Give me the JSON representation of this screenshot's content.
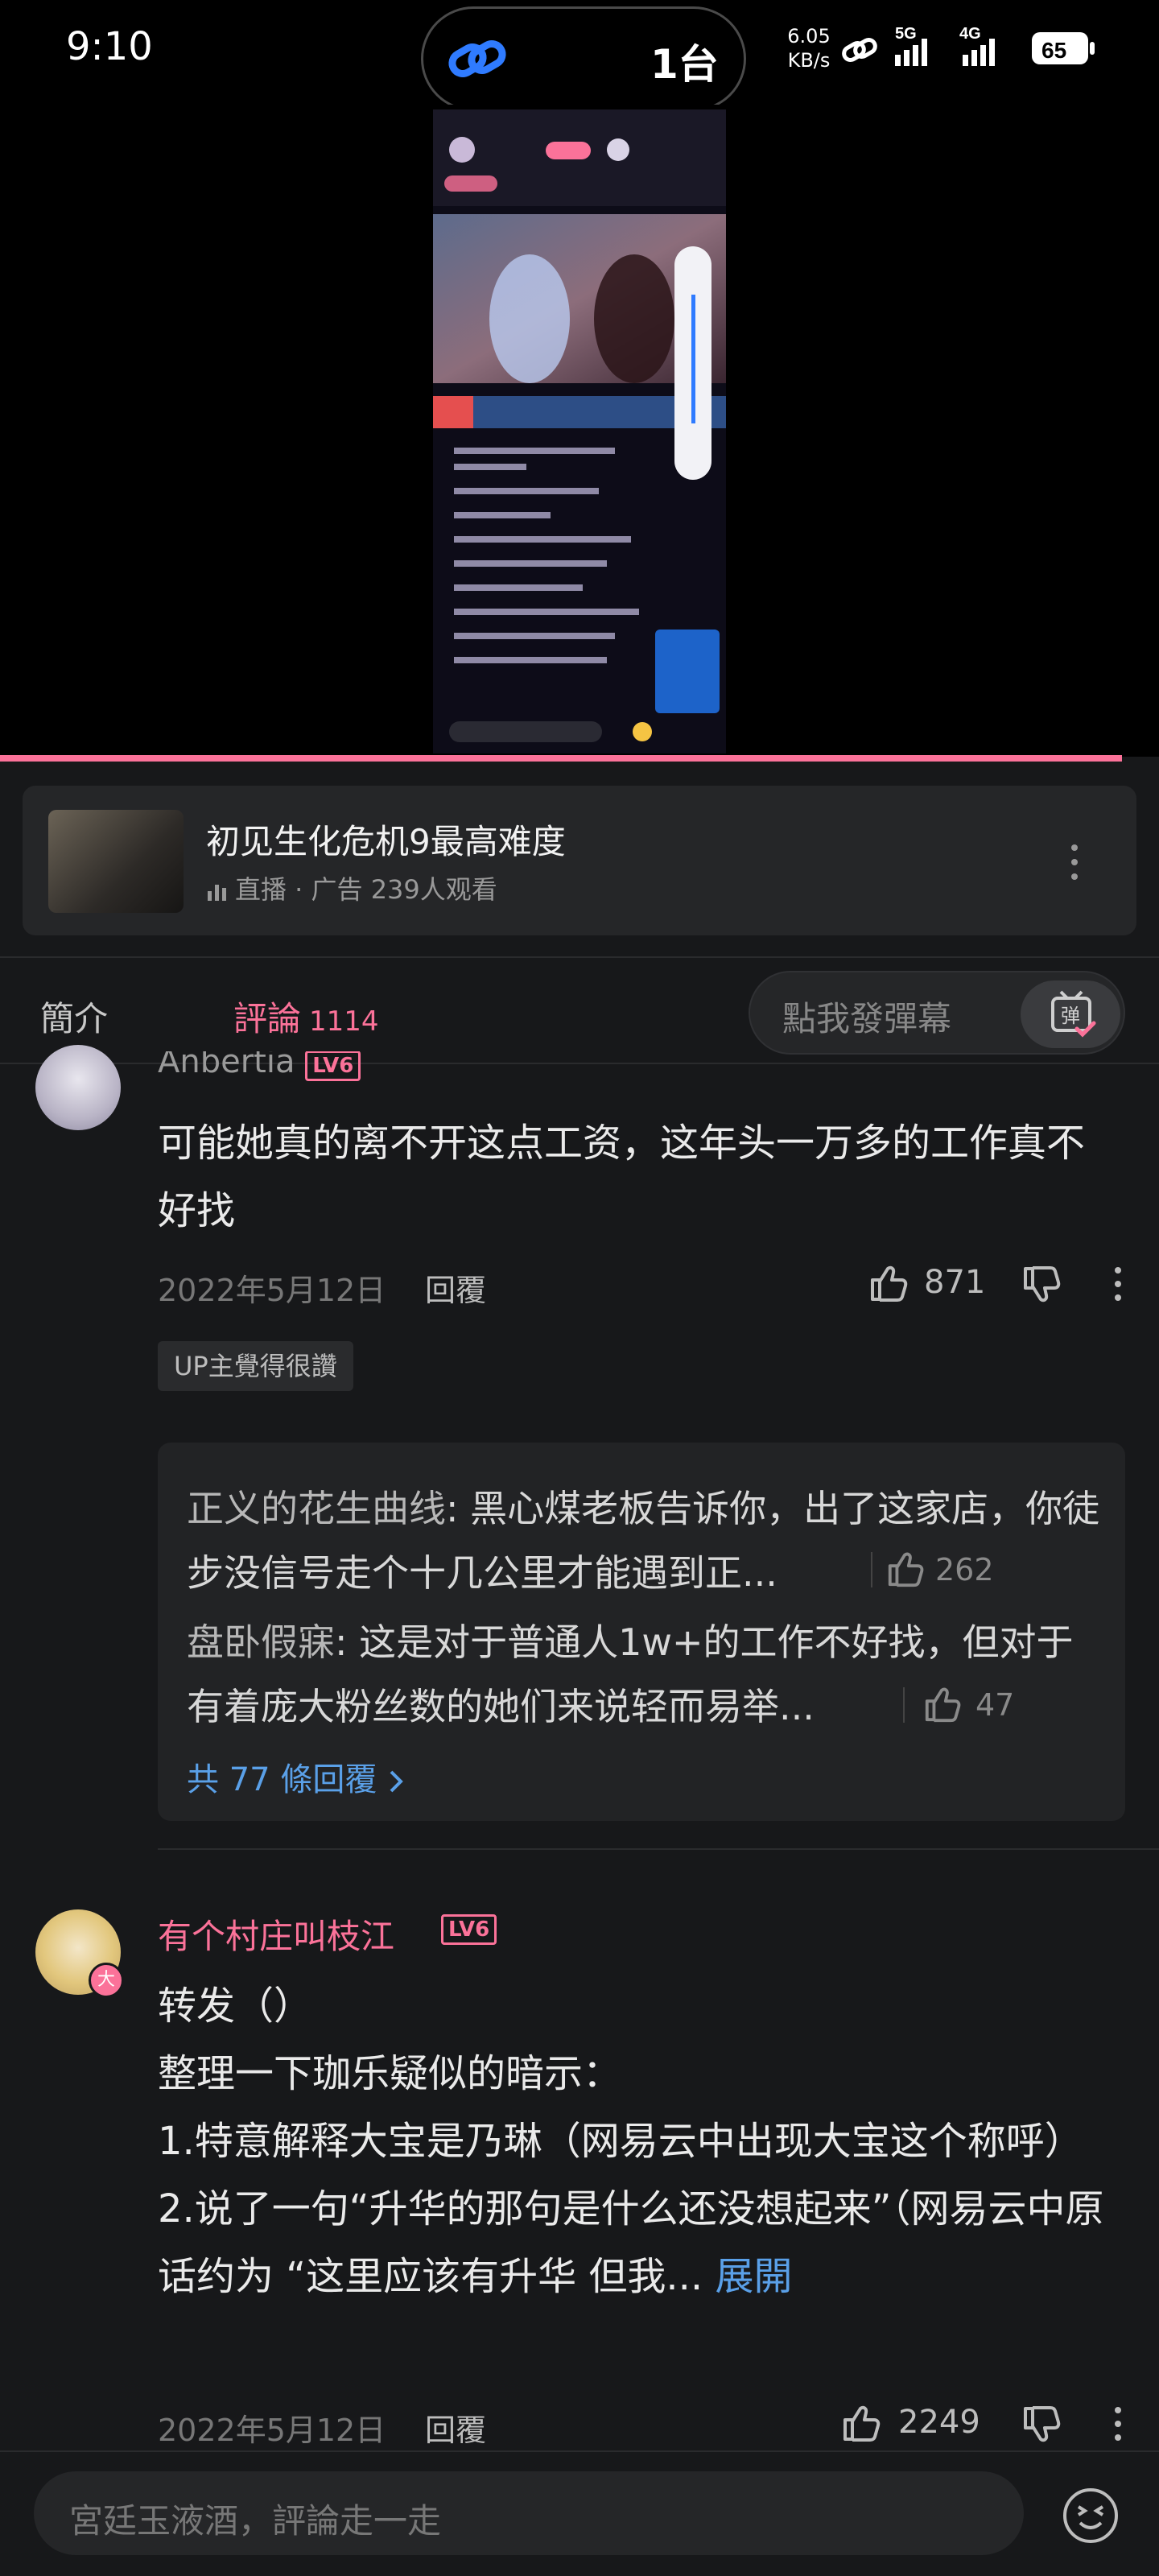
{
  "status_bar": {
    "time": "9:10",
    "island_text": "1台",
    "net_speed_value": "6.05",
    "net_speed_unit": "KB/s",
    "signal_1": "5G",
    "signal_2": "4G",
    "battery": "65"
  },
  "video": {
    "progress_color": "#fb7299"
  },
  "video_card": {
    "title": "初见生化危机9最高难度",
    "meta": "直播 · 广告  239人观看"
  },
  "tabs": {
    "intro": "簡介",
    "comments": "評論",
    "comments_count": "1114",
    "danmaku_placeholder": "點我發彈幕",
    "danmaku_icon_label": "弹"
  },
  "comments": [
    {
      "username": "Anbertia",
      "level": "LV6",
      "text": "可能她真的离不开这点工资，这年头一万多的工作真不好找",
      "date": "2022年5月12日",
      "reply_label": "回覆",
      "likes": "871",
      "badge": "UP主覺得很讚",
      "replies": [
        {
          "name": "正义的花生曲线",
          "text": ": 黑心煤老板告诉你，出了这家店，你徒步没信号走个十几公里才能遇到正...",
          "likes": "262"
        },
        {
          "name": "盘卧假寐",
          "text": ": 这是对于普通人1w+的工作不好找，但对于有着庞大粉丝数的她们来说轻而易举...",
          "likes": "47"
        }
      ],
      "more_replies": "共 77 條回覆"
    },
    {
      "username": "有个村庄叫枝江",
      "level": "LV6",
      "vip_badge": "大",
      "text_lines": [
        "转发（）",
        "整理一下珈乐疑似的暗示：",
        "1.特意解释大宝是乃琳（网易云中出现大宝这个称呼）",
        "2.说了一句“升华的那句是什么还没想起来”（网易云中原话约为 “这里应该有升华 但我..."
      ],
      "expand_label": "展開",
      "date": "2022年5月12日",
      "reply_label": "回覆",
      "likes": "2249"
    }
  ],
  "bottom_bar": {
    "placeholder": "宮廷玉液酒，評論走一走"
  }
}
